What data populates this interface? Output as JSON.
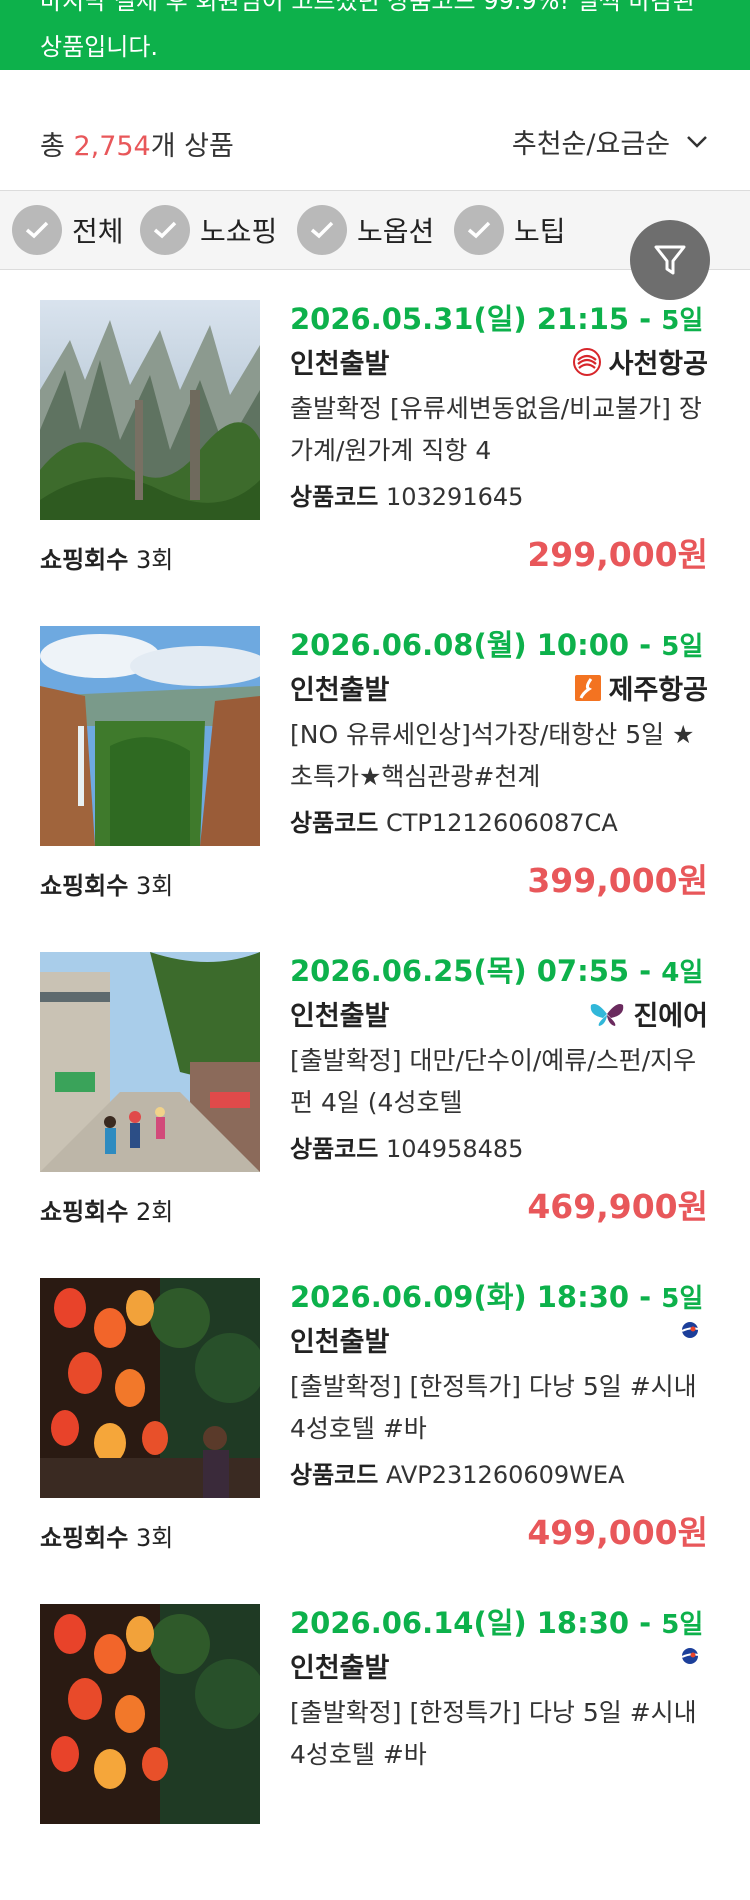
{
  "banner": {
    "text": "마지막 결제 후 회원님이 고르셨던 상품코드 99.9%! 일찍 마감된 상품입니다."
  },
  "summary": {
    "prefix": "총 ",
    "count": "2,754",
    "suffix": "개 상품",
    "sort_label": "추천순/요금순"
  },
  "filters": [
    {
      "label": "전체"
    },
    {
      "label": "노쇼핑"
    },
    {
      "label": "노옵션"
    },
    {
      "label": "노팁"
    }
  ],
  "labels": {
    "shopping": "쇼핑회수",
    "code": "상품코드"
  },
  "products": [
    {
      "date": "2026.05.31(일) 21:15 - ",
      "duration": "5일",
      "departure": "인천출발",
      "airline": "사천항공",
      "airline_icon": "sichuan-airlines-logo-icon",
      "title": "출발확정 [유류세변동없음/비교불가] 장가계/원가계 직항 4",
      "code": "103291645",
      "shopping": "3회",
      "price": "299,000원",
      "image": "zhangjiajie-mountains-photo"
    },
    {
      "date": "2026.06.08(월) 10:00 - ",
      "duration": "5일",
      "departure": "인천출발",
      "airline": "제주항공",
      "airline_icon": "jeju-air-logo-icon",
      "title": "[NO 유류세인상]석가장/태항산 5일 ★초특가★핵심관광#천계",
      "code": "CTP1212606087CA",
      "shopping": "3회",
      "price": "399,000원",
      "image": "taihang-canyon-photo"
    },
    {
      "date": "2026.06.25(목) 07:55 - ",
      "duration": "4일",
      "departure": "인천출발",
      "airline": "진에어",
      "airline_icon": "jinair-logo-icon",
      "title": "[출발확정] 대만/단수이/예류/스펀/지우펀 4일 (4성호텔",
      "code": "104958485",
      "shopping": "2회",
      "price": "469,900원",
      "image": "taiwan-street-photo"
    },
    {
      "date": "2026.06.09(화) 18:30 - ",
      "duration": "5일",
      "departure": "인천출발",
      "airline": "",
      "airline_icon": "vietnam-airline-logo-icon",
      "title": "[출발확정] [한정특가] 다낭 5일 #시내 4성호텔 #바",
      "code": "AVP231260609WEA",
      "shopping": "3회",
      "price": "499,000원",
      "image": "hoian-lanterns-photo"
    },
    {
      "date": "2026.06.14(일) 18:30 - ",
      "duration": "5일",
      "departure": "인천출발",
      "airline": "",
      "airline_icon": "vietnam-airline-logo-icon",
      "title": "[출발확정] [한정특가] 다낭 5일 #시내 4성호텔 #바",
      "code": "",
      "shopping": "",
      "price": "",
      "image": "hoian-lanterns-photo"
    }
  ],
  "colors": {
    "brand_green": "#0db14b",
    "price_red": "#e8575a",
    "chip_gray": "#b9b9b9",
    "fab_gray": "#6e6e6e"
  }
}
